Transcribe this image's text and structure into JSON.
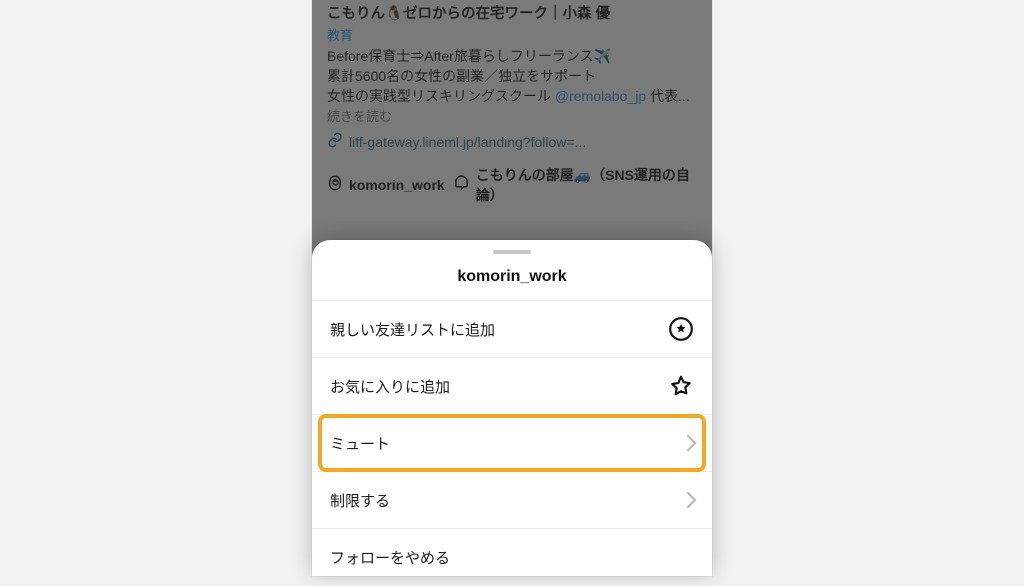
{
  "profile": {
    "display_name": "こもりん🐧ゼロからの在宅ワーク｜小森 優",
    "category": "教育",
    "bio_line1": "Before保育士⇒After旅暮らしフリーランス✈️",
    "bio_line2_a": "累計5600名の女性の副業／独立をサポート",
    "bio_line2_b": "女性の実践型リスキリングスクール ",
    "bio_mention": "@remolabo_jp",
    "bio_line2_c": " 代表...",
    "readmore": "続きを読む",
    "external_link": "liff-gateway.lineml.jp/landing?follow=...",
    "threads_handle": "komorin_work",
    "channel_name": "こもりんの部屋🚙（SNS運用の自論）"
  },
  "sheet": {
    "title": "komorin_work",
    "items": [
      {
        "label": "親しい友達リストに追加",
        "icon": "star-circle",
        "nav": false
      },
      {
        "label": "お気に入りに追加",
        "icon": "star-outline",
        "nav": false
      },
      {
        "label": "ミュート",
        "icon": "",
        "nav": true,
        "highlight": true
      },
      {
        "label": "制限する",
        "icon": "",
        "nav": true
      },
      {
        "label": "フォローをやめる",
        "icon": "",
        "nav": false
      }
    ]
  },
  "icons": {
    "link": "link-icon",
    "threads": "threads-icon",
    "channel": "broadcast-icon"
  }
}
